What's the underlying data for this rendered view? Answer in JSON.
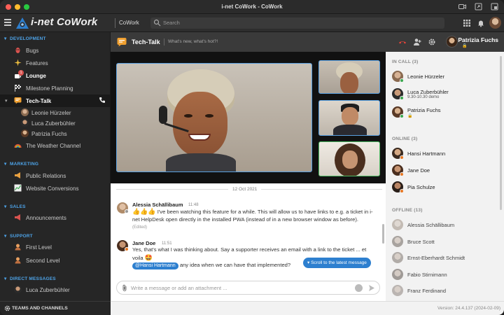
{
  "window": {
    "title": "i-net CoWork - CoWork"
  },
  "appbar": {
    "brand": "i-net CoWork",
    "section": "CoWork",
    "search_placeholder": "Search"
  },
  "sidebar": {
    "sections": [
      {
        "title": "DEVELOPMENT",
        "items": [
          {
            "label": "Bugs",
            "icon": "bug-icon"
          },
          {
            "label": "Features",
            "icon": "sparkle-icon"
          },
          {
            "label": "Lounge",
            "icon": "coffee-icon",
            "badge": "1",
            "bold": true
          },
          {
            "label": "Milestone Planning",
            "icon": "checkered-flag-icon"
          },
          {
            "label": "Tech-Talk",
            "icon": "chat-icon",
            "active": true,
            "members": [
              "Leonie Hürzeler",
              "Luca Zuberbühler",
              "Patrizia Fuchs"
            ]
          },
          {
            "label": "The Weather Channel",
            "icon": "rainbow-icon"
          }
        ]
      },
      {
        "title": "MARKETING",
        "items": [
          {
            "label": "Public Relations",
            "icon": "megaphone-icon"
          },
          {
            "label": "Website Conversions",
            "icon": "chart-icon"
          }
        ]
      },
      {
        "title": "SALES",
        "items": [
          {
            "label": "Announcements",
            "icon": "loudspeaker-icon"
          }
        ]
      },
      {
        "title": "SUPPORT",
        "items": [
          {
            "label": "First Level",
            "icon": "support-icon"
          },
          {
            "label": "Second Level",
            "icon": "support-icon"
          }
        ]
      },
      {
        "title": "DIRECT MESSAGES",
        "items": [
          {
            "label": "Luca Zuberbühler",
            "icon": "avatar"
          }
        ]
      }
    ],
    "footer_label": "TEAMS AND CHANNELS"
  },
  "channel": {
    "title": "Tech-Talk",
    "topic": "What's new, what's hot?!",
    "user_name": "Patrizia Fuchs",
    "user_status_emoji": "🔒"
  },
  "people": {
    "in_call": {
      "title": "IN CALL (3)",
      "members": [
        {
          "name": "Leonie Hürzeler",
          "status": "",
          "presence": "#3aa84f"
        },
        {
          "name": "Luca Zuberbühler",
          "status": "9.30-10.30 demo",
          "presence": "#3aa84f"
        },
        {
          "name": "Patrizia Fuchs",
          "status": "🔒",
          "presence": "#3aa84f"
        }
      ]
    },
    "online": {
      "title": "ONLINE (3)",
      "members": [
        {
          "name": "Hansi Hartmann",
          "presence": "#e87722"
        },
        {
          "name": "Jane Doe",
          "presence": "#e87722"
        },
        {
          "name": "Pia Schulze",
          "presence": "#e87722"
        }
      ]
    },
    "offline": {
      "title": "OFFLINE (13)",
      "members": [
        {
          "name": "Alessia Schällibaum"
        },
        {
          "name": "Bruce Scott"
        },
        {
          "name": "Ernst-Eberhardt Schmidt"
        },
        {
          "name": "Fabio Stirnimann"
        },
        {
          "name": "Franz Ferdinand"
        }
      ]
    }
  },
  "chat": {
    "date": "12 Oct 2021",
    "messages": [
      {
        "author": "Alessia Schällibaum",
        "time": "11:48",
        "emoji": "👍👍👍",
        "text": "I've been watching this feature for a while. This will allow us to have links to e.g. a ticket in i-net HelpDesk open directly in the installed PWA (instead of in a new browser window as before).",
        "edited": "(Edited)"
      },
      {
        "author": "Jane Doe",
        "time": "11:51",
        "text": "Yes, that's what I was thinking about. Say a supporter receives an email with a link to the ticket ... et voila",
        "emoji": "🤩",
        "mention": "@Hansi Hartmann",
        "text2": "any idea when we can have that implemented?"
      }
    ],
    "scroll_button": "▾ Scroll to the latest message",
    "composer_placeholder": "Write a message or add an attachment ..."
  },
  "footer": {
    "version": "Version: 24.4.137 (2024-02-09)"
  },
  "colors": {
    "accent": "#2d7fcf",
    "section_header": "#4da3e8",
    "online": "#3aa84f",
    "away": "#e87722"
  }
}
